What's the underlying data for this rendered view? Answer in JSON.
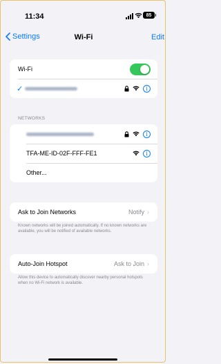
{
  "status": {
    "time": "11:34",
    "battery": "85"
  },
  "nav": {
    "back_label": "Settings",
    "title": "Wi-Fi",
    "edit_label": "Edit"
  },
  "wifi": {
    "label": "Wi-Fi",
    "enabled": true
  },
  "networks": {
    "header": "NETWORKS",
    "items": [
      {
        "name": "TFA-ME-ID-02F-FFF-FE1"
      },
      {
        "name": "Other..."
      }
    ]
  },
  "ask_join": {
    "label": "Ask to Join Networks",
    "value": "Notify",
    "footnote": "Known networks will be joined automatically. If no known networks are available, you will be notified of available networks."
  },
  "auto_join": {
    "label": "Auto-Join Hotspot",
    "value": "Ask to Join",
    "footnote": "Allow this device to automatically discover nearby personal hotspots when no Wi-Fi network is available."
  },
  "colors": {
    "accent": "#0a7aff",
    "toggle_on": "#34c759",
    "background": "#f2f2f7"
  }
}
